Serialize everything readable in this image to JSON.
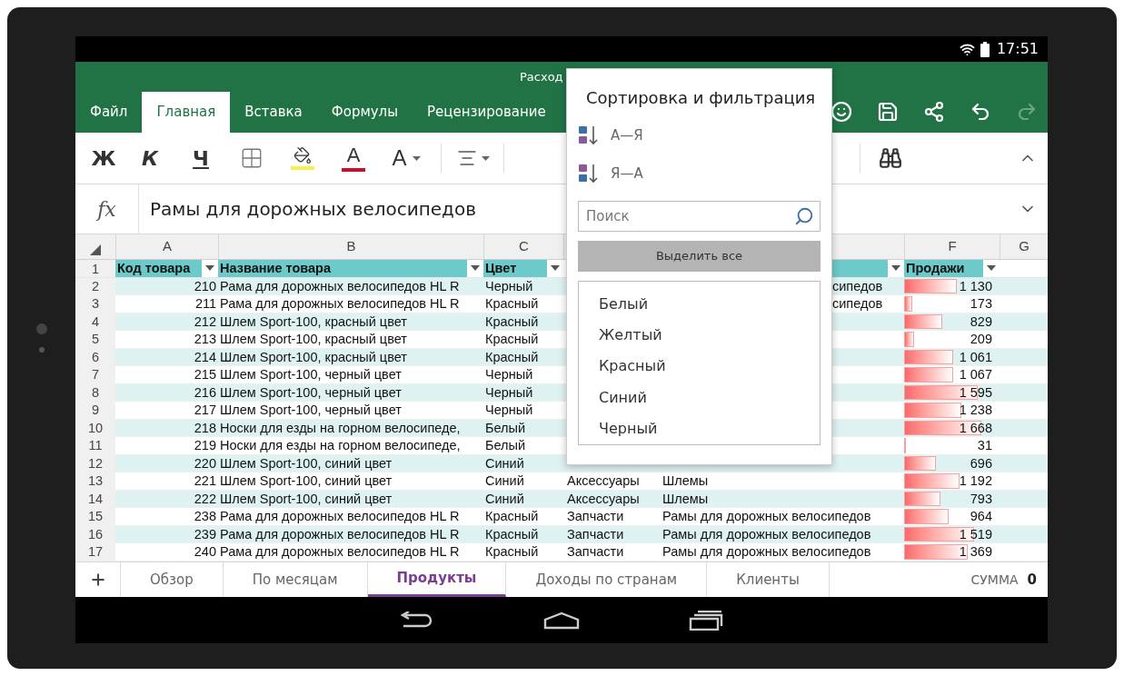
{
  "status_bar": {
    "time": "17:51"
  },
  "title_bar": {
    "title": "Расход"
  },
  "ribbon_tabs": [
    {
      "label": "Файл",
      "selected": false
    },
    {
      "label": "Главная",
      "selected": true
    },
    {
      "label": "Вставка",
      "selected": false
    },
    {
      "label": "Формулы",
      "selected": false
    },
    {
      "label": "Рецензирование",
      "selected": false
    }
  ],
  "title_actions": [
    {
      "kind": "smile",
      "disabled": false
    },
    {
      "kind": "save",
      "disabled": false
    },
    {
      "kind": "share",
      "disabled": false
    },
    {
      "kind": "undo",
      "disabled": false
    },
    {
      "kind": "redo",
      "disabled": true
    }
  ],
  "toolbar": {
    "bold": "Ж",
    "italic": "К",
    "underline": "Ч",
    "font_color": "А",
    "font_size": "A"
  },
  "formula_bar": {
    "label": "fx",
    "value": "Рамы для дорожных велосипедов"
  },
  "column_headers": [
    "A",
    "B",
    "C",
    "F",
    "G"
  ],
  "header_row": {
    "row": "1",
    "code": "Код товара",
    "name": "Название товара",
    "product_color": "Цвет",
    "sales": "Продажи"
  },
  "rows": [
    {
      "row": "2",
      "code": "210",
      "name": "Рама для дорожных велосипедов HL R",
      "product_color": "Черный",
      "subcategory_tail": "сипедов",
      "sales": "1 130"
    },
    {
      "row": "3",
      "code": "211",
      "name": "Рама для дорожных велосипедов HL R",
      "product_color": "Красный",
      "subcategory_tail": "сипедов",
      "sales": "173"
    },
    {
      "row": "4",
      "code": "212",
      "name": "Шлем Sport-100, красный цвет",
      "product_color": "Красный",
      "sales": "829"
    },
    {
      "row": "5",
      "code": "213",
      "name": "Шлем Sport-100, красный цвет",
      "product_color": "Красный",
      "sales": "209"
    },
    {
      "row": "6",
      "code": "214",
      "name": "Шлем Sport-100, красный цвет",
      "product_color": "Красный",
      "sales": "1 061"
    },
    {
      "row": "7",
      "code": "215",
      "name": "Шлем Sport-100, черный цвет",
      "product_color": "Черный",
      "sales": "1 067"
    },
    {
      "row": "8",
      "code": "216",
      "name": "Шлем Sport-100, черный цвет",
      "product_color": "Черный",
      "sales": "1 595"
    },
    {
      "row": "9",
      "code": "217",
      "name": "Шлем Sport-100, черный цвет",
      "product_color": "Черный",
      "sales": "1 238"
    },
    {
      "row": "10",
      "code": "218",
      "name": "Носки для езды на горном велосипеде,",
      "product_color": "Белый",
      "sales": "1 668"
    },
    {
      "row": "11",
      "code": "219",
      "name": "Носки для езды на горном велосипеде,",
      "product_color": "Белый",
      "sales": "31"
    },
    {
      "row": "12",
      "code": "220",
      "name": "Шлем Sport-100, синий цвет",
      "product_color": "Синий",
      "sales": "696"
    },
    {
      "row": "13",
      "code": "221",
      "name": "Шлем Sport-100, синий цвет",
      "product_color": "Синий",
      "category": "Аксессуары",
      "subcategory": "Шлемы",
      "sales": "1 192"
    },
    {
      "row": "14",
      "code": "222",
      "name": "Шлем Sport-100, синий цвет",
      "product_color": "Синий",
      "category": "Аксессуары",
      "subcategory": "Шлемы",
      "sales": "793"
    },
    {
      "row": "15",
      "code": "238",
      "name": "Рама для дорожных велосипедов HL R",
      "product_color": "Красный",
      "category": "Запчасти",
      "subcategory": "Рамы для дорожных велосипедов",
      "sales": "964"
    },
    {
      "row": "16",
      "code": "239",
      "name": "Рама для дорожных велосипедов HL R",
      "product_color": "Красный",
      "category": "Запчасти",
      "subcategory": "Рамы для дорожных велосипедов",
      "sales": "1 519"
    },
    {
      "row": "17",
      "code": "240",
      "name": "Рама для дорожных велосипедов HL R",
      "product_color": "Красный",
      "category": "Запчасти",
      "subcategory": "Рамы для дорожных велосипедов",
      "sales": "1 369"
    }
  ],
  "sort_filter_panel": {
    "title": "Сортировка и фильтрация",
    "sort_options": [
      {
        "label": "А—Я",
        "kind": "ascending"
      },
      {
        "label": "Я—А",
        "kind": "descending"
      }
    ],
    "search": {
      "placeholder": "Поиск"
    },
    "select_all": "Выделить все",
    "values": [
      "Белый",
      "Желтый",
      "Красный",
      "Синий",
      "Черный"
    ]
  },
  "sheet_tabs": [
    {
      "label": "Обзор",
      "selected": false
    },
    {
      "label": "По месяцам",
      "selected": false
    },
    {
      "label": "Продукты",
      "selected": true
    },
    {
      "label": "Доходы по странам",
      "selected": false
    },
    {
      "label": "Клиенты",
      "selected": false
    }
  ],
  "summary": {
    "label": "СУММА",
    "value": "0"
  }
}
